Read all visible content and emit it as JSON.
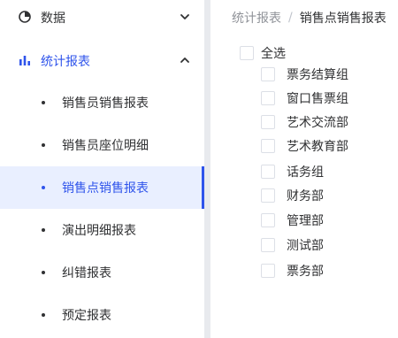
{
  "sidebar": {
    "menus": [
      {
        "label": "数据",
        "icon": "pie-chart-icon",
        "expanded": false
      },
      {
        "label": "统计报表",
        "icon": "bar-chart-icon",
        "expanded": true
      }
    ],
    "sub_items": [
      {
        "label": "销售员销售报表",
        "active": false
      },
      {
        "label": "销售员座位明细",
        "active": false
      },
      {
        "label": "销售点销售报表",
        "active": true
      },
      {
        "label": "演出明细报表",
        "active": false
      },
      {
        "label": "纠错报表",
        "active": false
      },
      {
        "label": "预定报表",
        "active": false
      }
    ],
    "accent_color": "#2f54eb"
  },
  "breadcrumb": {
    "parent": "统计报表",
    "separator": "/",
    "current": "销售点销售报表"
  },
  "tree": {
    "select_all": "全选",
    "items": [
      "票务结算组",
      "窗口售票组",
      "艺术交流部",
      "艺术教育部",
      "话务组",
      "财务部",
      "管理部",
      "测试部",
      "票务部"
    ]
  }
}
